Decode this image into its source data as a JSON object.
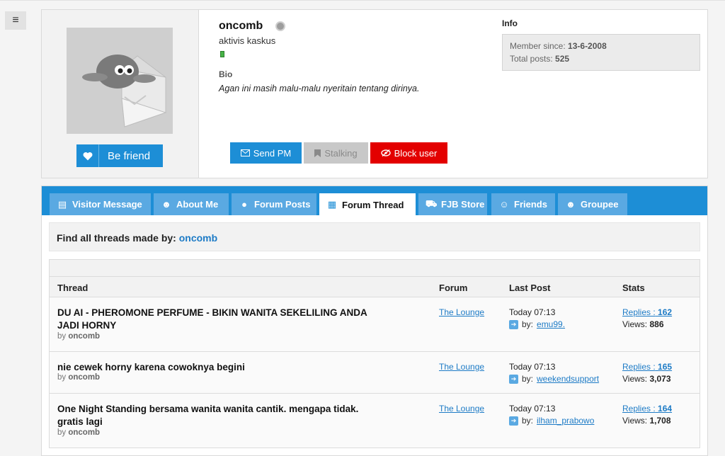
{
  "nav": {
    "menu_icon": "hamburger-icon",
    "menu_glyph": "≡"
  },
  "profile": {
    "username": "oncomb",
    "user_title": "aktivis kaskus",
    "bio_label": "Bio",
    "bio_text": "Agan ini masih malu-malu nyeritain tentang dirinya.",
    "befriend_label": "Be friend",
    "info_label": "Info",
    "member_since_label": "Member since:",
    "member_since": "13-6-2008",
    "total_posts_label": "Total posts:",
    "total_posts": "525",
    "actions": {
      "send_pm": "Send PM",
      "stalking": "Stalking",
      "block_user": "Block user"
    }
  },
  "tabs": [
    {
      "label": "Visitor Message",
      "icon": "message-icon"
    },
    {
      "label": "About Me",
      "icon": "user-icon"
    },
    {
      "label": "Forum Posts",
      "icon": "chat-icon"
    },
    {
      "label": "Forum Thread",
      "icon": "calendar-icon",
      "active": true
    },
    {
      "label": "FJB Store",
      "icon": "cart-icon"
    },
    {
      "label": "Friends",
      "icon": "friend-icon"
    },
    {
      "label": "Groupee",
      "icon": "group-icon"
    }
  ],
  "find": {
    "prefix": "Find all threads made by:",
    "user": "oncomb"
  },
  "table": {
    "headers": {
      "thread": "Thread",
      "forum": "Forum",
      "last_post": "Last Post",
      "stats": "Stats"
    },
    "rows": [
      {
        "title": "DU AI - PHEROMONE PERFUME - BIKIN WANITA SEKELILING ANDA JADI HORNY",
        "by_label": "by",
        "by": "oncomb",
        "forum": "The Lounge",
        "time": "Today 07:13",
        "last_by_label": "by:",
        "last_by": "emu99.",
        "replies_label": "Replies :",
        "replies": "162",
        "views_label": "Views:",
        "views": "886"
      },
      {
        "title": "nie cewek horny karena cowoknya begini",
        "by_label": "by",
        "by": "oncomb",
        "forum": "The Lounge",
        "time": "Today 07:13",
        "last_by_label": "by:",
        "last_by": "weekendsupport",
        "replies_label": "Replies :",
        "replies": "165",
        "views_label": "Views:",
        "views": "3,073"
      },
      {
        "title": "One Night Standing bersama wanita wanita cantik. mengapa tidak. gratis lagi",
        "by_label": "by",
        "by": "oncomb",
        "forum": "The Lounge",
        "time": "Today 07:13",
        "last_by_label": "by:",
        "last_by": "ilham_prabowo",
        "replies_label": "Replies :",
        "replies": "164",
        "views_label": "Views:",
        "views": "1,708"
      }
    ]
  },
  "colors": {
    "accent": "#1d8ed6",
    "tab_bg": "#5aa9e2",
    "danger": "#e30000",
    "online_green": "#47b347"
  }
}
